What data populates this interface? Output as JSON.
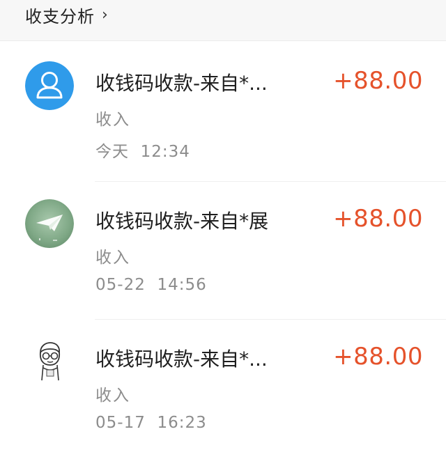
{
  "header": {
    "title": "收支分析",
    "chevron": "›"
  },
  "colors": {
    "amount": "#e5522b",
    "title": "#1f1f1f",
    "secondary": "#8c8c8c",
    "default_avatar": "#2f9bea"
  },
  "transactions": [
    {
      "avatar_icon": "default-user-avatar-icon",
      "title": "收钱码收款-来自*...",
      "type": "收入",
      "time": "今天  12:34",
      "amount": "+88.00"
    },
    {
      "avatar_icon": "paper-plane-avatar-icon",
      "title": "收钱码收款-来自*展",
      "type": "收入",
      "time": "05-22  14:56",
      "amount": "+88.00"
    },
    {
      "avatar_icon": "cartoon-person-glasses-avatar-icon",
      "title": "收钱码收款-来自*...",
      "type": "收入",
      "time": "05-17  16:23",
      "amount": "+88.00"
    }
  ]
}
